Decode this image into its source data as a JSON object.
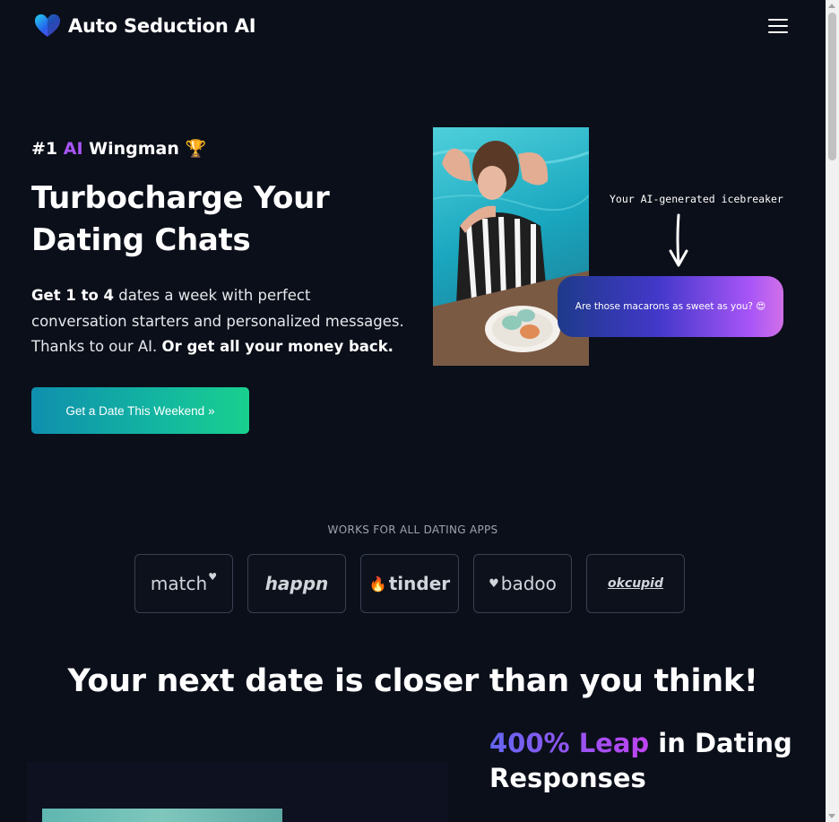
{
  "header": {
    "brand": "Auto Seduction AI",
    "logo_icon": "heart-icon",
    "menu_icon": "hamburger-menu-icon"
  },
  "hero": {
    "tagline_prefix": "#1 ",
    "tagline_ai": "AI",
    "tagline_suffix": " Wingman ",
    "tagline_emoji": "🏆",
    "title_line1": "Turbocharge Your",
    "title_line2": "Dating Chats",
    "desc_bold1": "Get 1 to 4",
    "desc_text1": " dates a week with perfect conversation starters and personalized messages. Thanks to our AI. ",
    "desc_bold2": "Or get all your money back.",
    "cta_label": "Get a Date This Weekend",
    "cta_icon": "»"
  },
  "demo": {
    "caption": "Your AI-generated icebreaker",
    "bubble_text": "Are those macarons as sweet as you? 😍"
  },
  "apps": {
    "heading": "WORKS FOR ALL DATING APPS",
    "items": [
      "match",
      "happn",
      "tinder",
      "badoo",
      "okcupid"
    ]
  },
  "section": {
    "title": "Your next date is closer than you think!",
    "leap_highlight": "400% Leap",
    "leap_rest": " in Dating Responses"
  },
  "colors": {
    "background": "#0b0f1a",
    "accent_purple": "#a855f7",
    "cta_start": "#0f8fae",
    "cta_end": "#19d08e"
  }
}
